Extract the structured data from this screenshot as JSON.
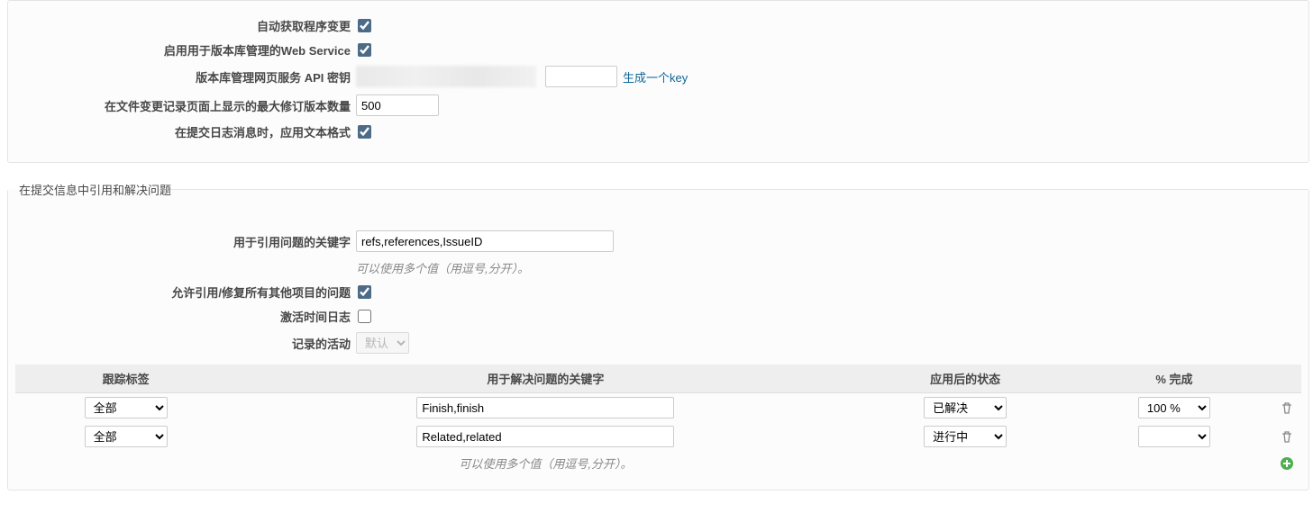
{
  "section1": {
    "autofetch_label": "自动获取程序变更",
    "autofetch_checked": true,
    "webservice_label": "启用用于版本库管理的Web Service",
    "webservice_checked": true,
    "apikey_label": "版本库管理网页服务 API 密钥",
    "apikey_value": "",
    "apikey_generate": "生成一个key",
    "maxrev_label": "在文件变更记录页面上显示的最大修订版本数量",
    "maxrev_value": "500",
    "textfmt_label": "在提交日志消息时，应用文本格式",
    "textfmt_checked": true
  },
  "section2": {
    "legend": "在提交信息中引用和解决问题",
    "refkw_label": "用于引用问题的关键字",
    "refkw_value": "refs,references,IssueID",
    "refkw_hint": "可以使用多个值（用逗号,分开）。",
    "allowcross_label": "允许引用/修复所有其他项目的问题",
    "allowcross_checked": true,
    "timelog_label": "激活时间日志",
    "timelog_checked": false,
    "activity_label": "记录的活动",
    "activity_value": "默认",
    "activity_disabled": true
  },
  "table": {
    "headers": {
      "tracker": "跟踪标签",
      "fixkw": "用于解决问题的关键字",
      "status": "应用后的状态",
      "done": "% 完成"
    },
    "rows": [
      {
        "tracker": "全部",
        "kw": "Finish,finish",
        "status": "已解决",
        "done": "100 %"
      },
      {
        "tracker": "全部",
        "kw": "Related,related",
        "status": "进行中",
        "done": ""
      }
    ],
    "hint": "可以使用多个值（用逗号,分开）。"
  }
}
